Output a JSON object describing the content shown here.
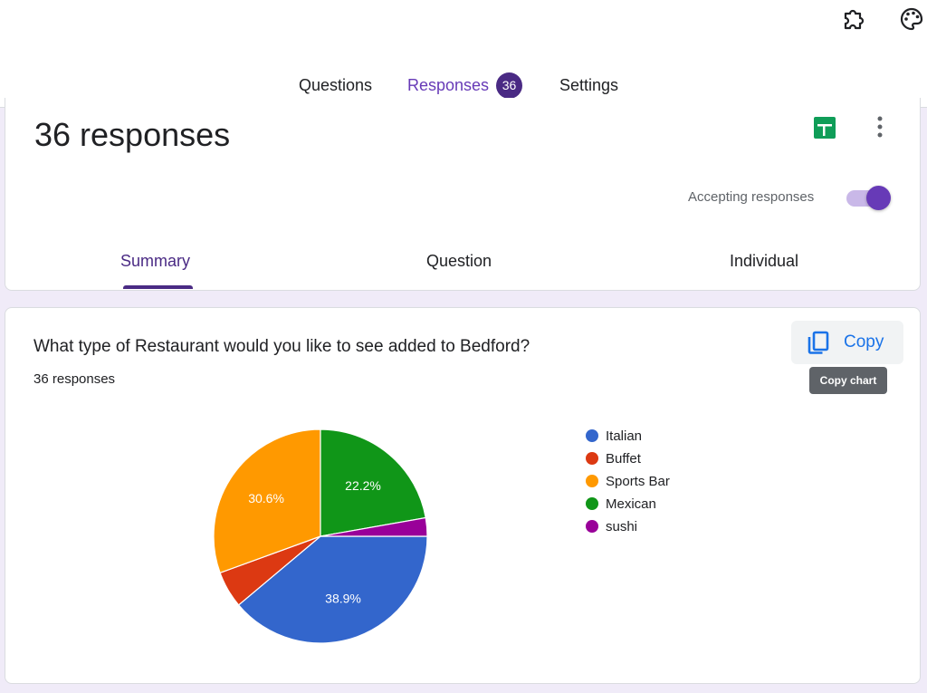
{
  "toolbar": {
    "icons": [
      "puzzle-icon",
      "palette-icon"
    ]
  },
  "tabs": {
    "questions": "Questions",
    "responses": "Responses",
    "responses_count": "36",
    "settings": "Settings"
  },
  "summary_card": {
    "title": "36 responses",
    "accepting_label": "Accepting responses",
    "accepting_on": true,
    "subtabs": {
      "summary": "Summary",
      "question": "Question",
      "individual": "Individual"
    }
  },
  "question_card": {
    "title": "What type of Restaurant would you like to see added to Bedford?",
    "responses": "36 responses",
    "copy_label": "Copy",
    "tooltip": "Copy chart"
  },
  "colors": {
    "accent": "#673ab7",
    "sheets_green": "#0f9d58",
    "copy_blue": "#1a73e8"
  },
  "chart_data": {
    "type": "pie",
    "categories": [
      "Italian",
      "Buffet",
      "Sports Bar",
      "Mexican",
      "sushi"
    ],
    "values": [
      14,
      2,
      11,
      8,
      1
    ],
    "percent_labels": [
      "38.9%",
      "",
      "30.6%",
      "22.2%",
      ""
    ],
    "colors": [
      "#3366cc",
      "#dc3912",
      "#ff9900",
      "#109618",
      "#990099"
    ],
    "legend_position": "right"
  }
}
